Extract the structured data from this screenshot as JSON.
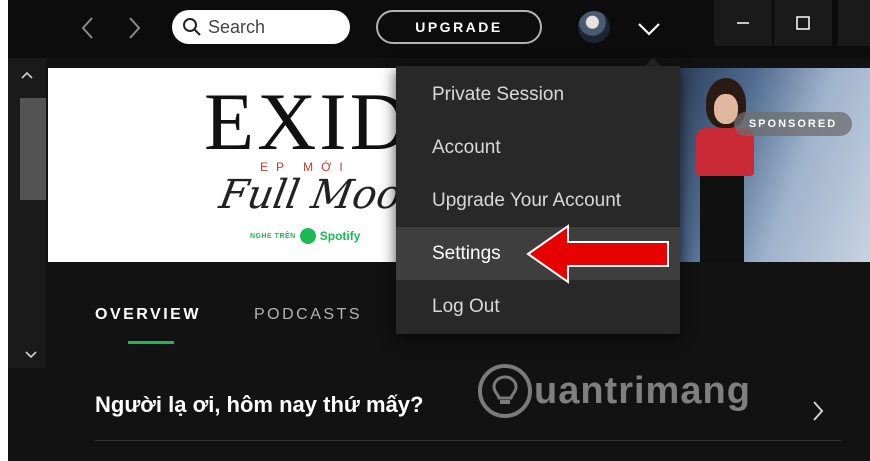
{
  "titlebar": {
    "back_icon": "chevron-left-icon",
    "forward_icon": "chevron-right-icon",
    "search": {
      "placeholder": "Search",
      "icon": "search-icon"
    },
    "upgrade_label": "UPGRADE",
    "avatar_icon": "user-avatar",
    "menu_toggle_icon": "chevron-down-icon",
    "window_controls": {
      "minimize_icon": "minimize-icon",
      "maximize_icon": "maximize-icon"
    }
  },
  "scrollbar": {
    "up_icon": "chevron-up-icon",
    "down_icon": "chevron-down-icon"
  },
  "banner": {
    "brand": "EXID",
    "subtitle": "EP MỚI",
    "script_title": "Full Moon",
    "listen_on": "NGHE TRÊN",
    "platform": "Spotify",
    "sponsored_label": "SPONSORED"
  },
  "user_menu": {
    "items": [
      {
        "label": "Private Session"
      },
      {
        "label": "Account"
      },
      {
        "label": "Upgrade Your Account"
      },
      {
        "label": "Settings",
        "highlighted": true
      },
      {
        "label": "Log Out"
      }
    ]
  },
  "content": {
    "tabs": [
      {
        "label": "OVERVIEW",
        "active": true
      },
      {
        "label": "PODCASTS",
        "active": false
      }
    ],
    "section_title": "Người lạ ơi, hôm nay thứ mấy?",
    "section_more_icon": "chevron-right-icon"
  },
  "watermark": {
    "text": "uantrimang"
  },
  "colors": {
    "background": "#121212",
    "menu_bg": "#282828",
    "menu_highlight": "#3e3e3e",
    "accent_green": "#1db954",
    "annotation_red": "#e60000"
  }
}
